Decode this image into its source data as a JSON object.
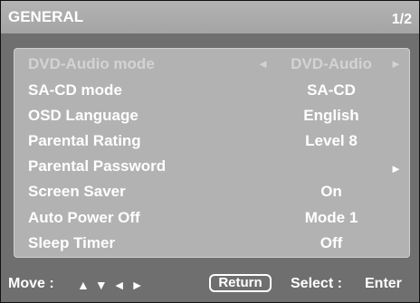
{
  "header": {
    "title": "GENERAL",
    "page": "1/2"
  },
  "menu": {
    "items": [
      {
        "label": "DVD-Audio mode",
        "value": "DVD-Audio",
        "left_arrow": "◄",
        "right_arrow": "►"
      },
      {
        "label": "SA-CD mode",
        "value": "SA-CD"
      },
      {
        "label": "OSD Language",
        "value": "English"
      },
      {
        "label": "Parental Rating",
        "value": "Level 8"
      },
      {
        "label": "Parental Password",
        "value": "",
        "right_arrow": "►"
      },
      {
        "label": "Screen Saver",
        "value": "On"
      },
      {
        "label": "Auto Power Off",
        "value": "Mode 1"
      },
      {
        "label": "Sleep Timer",
        "value": "Off"
      }
    ]
  },
  "footer": {
    "move_label": "Move :",
    "nav_icons": "▲▼◄►",
    "return_label": "Return",
    "select_label": "Select :",
    "enter_label": "Enter"
  },
  "colors": {
    "background": "#6f6f6f",
    "panel": "#b2b2b2",
    "header": "#aaaaaa",
    "text": "#ffffff"
  }
}
